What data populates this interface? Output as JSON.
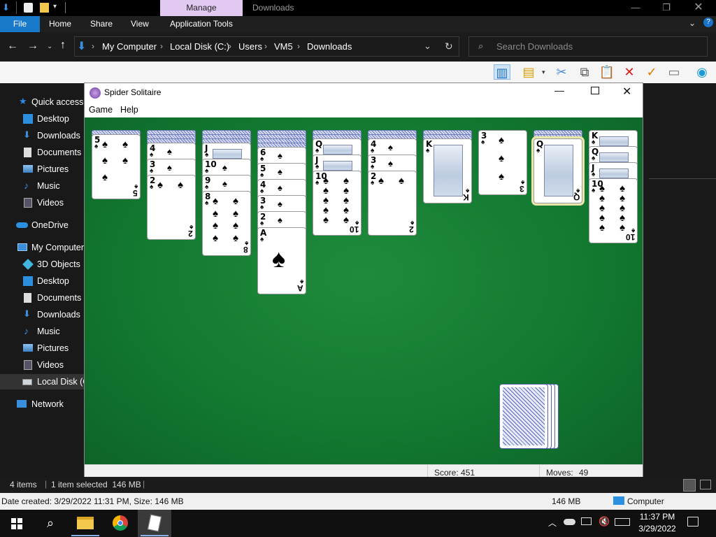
{
  "explorer": {
    "title": "Downloads",
    "manage_tab": "Manage",
    "ribbon_tabs": [
      "File",
      "Home",
      "Share",
      "View",
      "Application Tools"
    ],
    "breadcrumb": [
      "My Computer",
      "Local Disk (C:)",
      "Users",
      "VM5",
      "Downloads"
    ],
    "search_placeholder": "Search Downloads",
    "sidebar": {
      "quick_access": "Quick access",
      "quick_items": [
        "Desktop",
        "Downloads",
        "Documents",
        "Pictures",
        "Music",
        "Videos"
      ],
      "onedrive": "OneDrive",
      "my_computer": "My Computer",
      "computer_items": [
        "3D Objects",
        "Desktop",
        "Documents",
        "Downloads",
        "Music",
        "Pictures",
        "Videos",
        "Local Disk (C"
      ],
      "network": "Network"
    },
    "status": {
      "items": "4 items",
      "selected": "1 item selected  146 MB"
    },
    "details": {
      "left": "Date created: 3/29/2022 11:31 PM, Size: 146 MB",
      "size": "146 MB",
      "location": "Computer"
    }
  },
  "solitaire": {
    "title": "Spider Solitaire",
    "menu": [
      "Game",
      "Help"
    ],
    "score_label": "Score: 451",
    "moves_label": "Moves:",
    "moves_value": "49",
    "columns": [
      {
        "backs": 1,
        "cards": [
          "5"
        ]
      },
      {
        "backs": 3,
        "cards": [
          "4",
          "3",
          "2"
        ]
      },
      {
        "backs": 3,
        "cards": [
          "J",
          "10",
          "9",
          "8"
        ]
      },
      {
        "backs": 4,
        "cards": [
          "6",
          "5",
          "4",
          "3",
          "2",
          "A"
        ]
      },
      {
        "backs": 2,
        "cards": [
          "Q",
          "J",
          "10"
        ]
      },
      {
        "backs": 2,
        "cards": [
          "4",
          "3",
          "2"
        ]
      },
      {
        "backs": 2,
        "cards": [
          "K"
        ]
      },
      {
        "backs": 0,
        "cards": [
          "3"
        ]
      },
      {
        "backs": 2,
        "cards": [
          "Q"
        ]
      },
      {
        "backs": 0,
        "cards": [
          "K",
          "Q",
          "J",
          "10"
        ]
      }
    ],
    "stock_piles": 4
  },
  "taskbar": {
    "time": "11:37 PM",
    "date": "3/29/2022"
  }
}
